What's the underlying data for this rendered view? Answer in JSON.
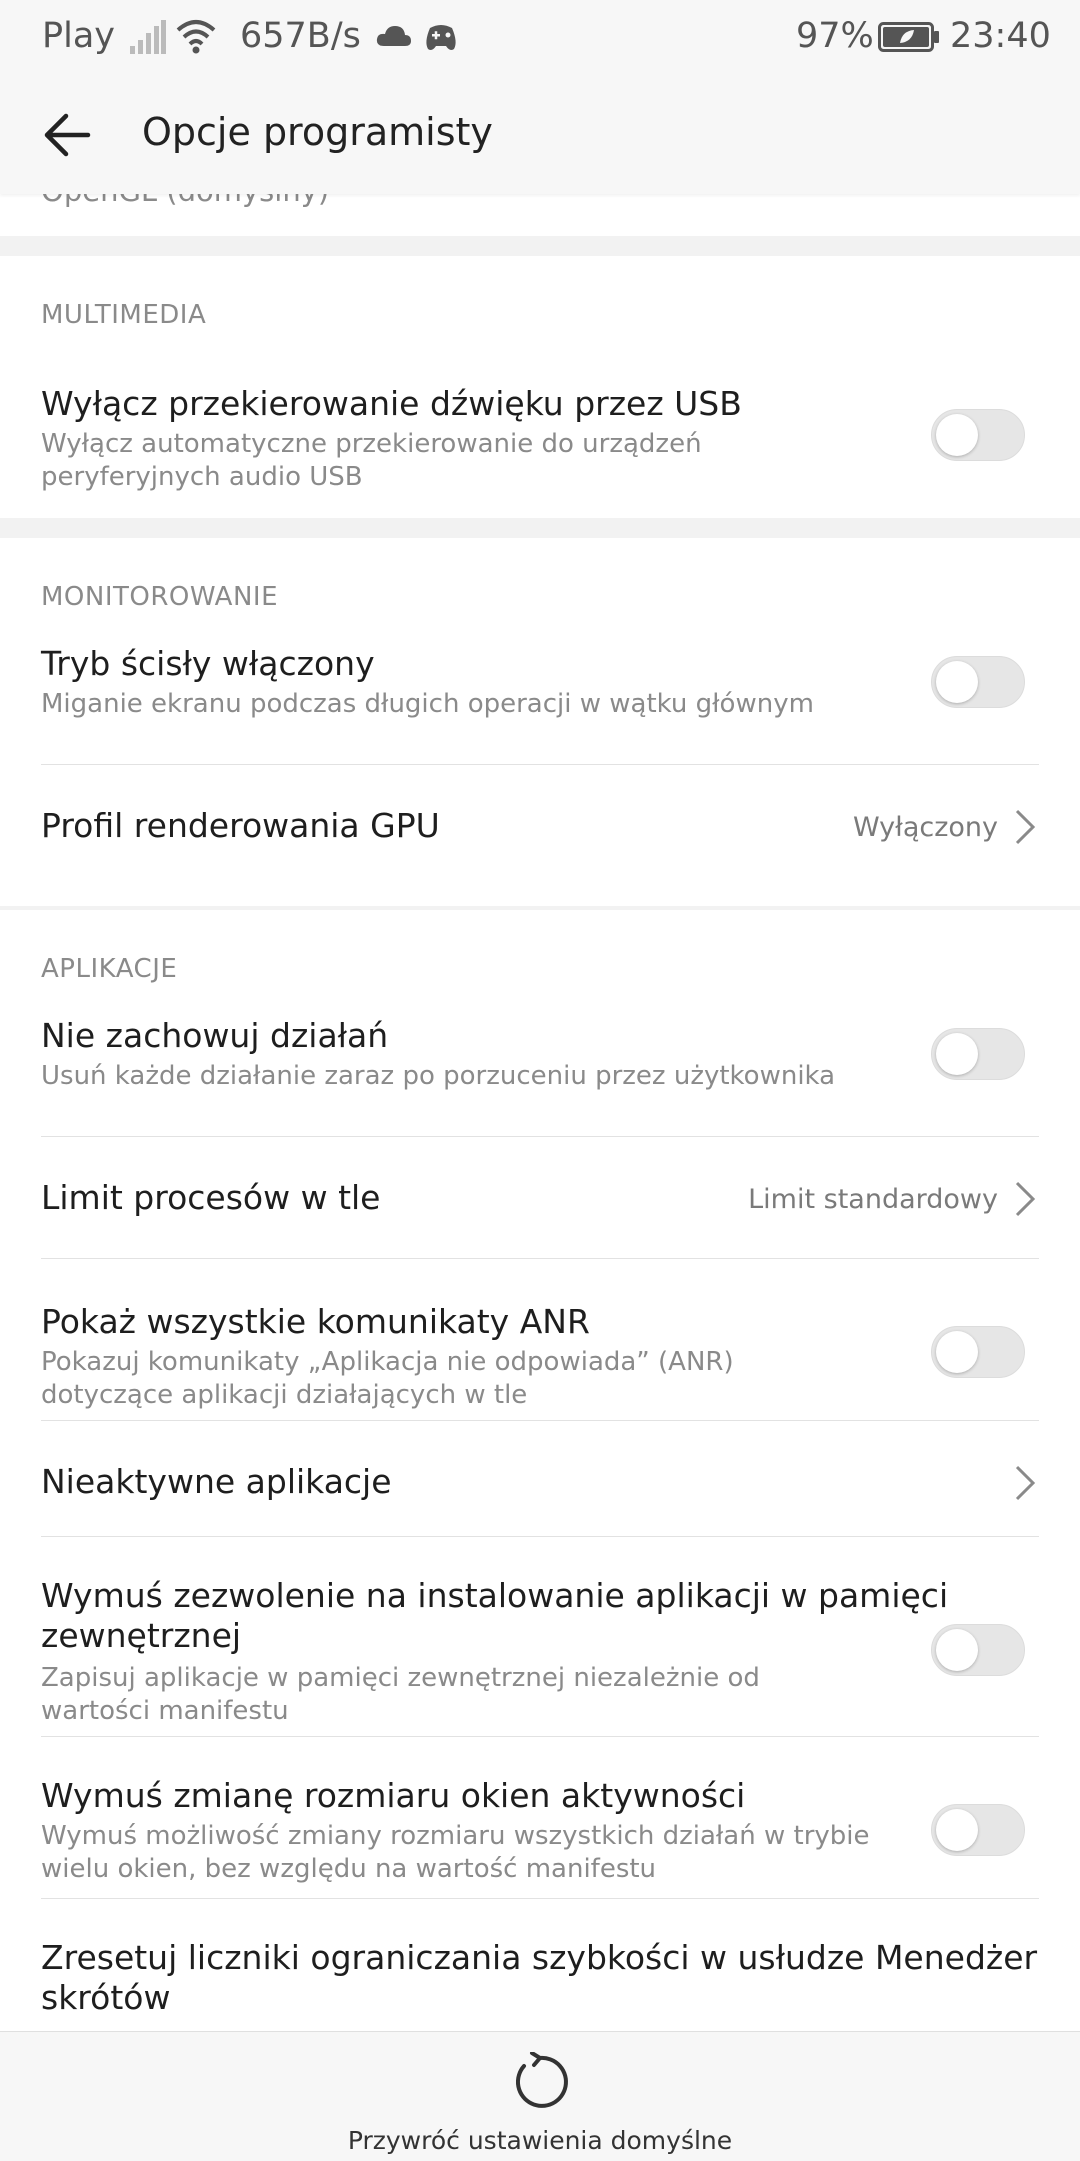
{
  "status_bar": {
    "carrier": "Play",
    "speed": "657B/s",
    "battery": "97%",
    "time": "23:40"
  },
  "header": {
    "title": "Opcje programisty"
  },
  "top_clipped_text": "OpenGL (domyślny)",
  "sections": {
    "multimedia": {
      "header": "MULTIMEDIA",
      "usb_audio": {
        "title": "Wyłącz przekierowanie dźwięku przez USB",
        "subtitle": "Wyłącz automatyczne przekierowanie do urządzeń peryferyjnych audio USB",
        "enabled": false
      }
    },
    "monitoring": {
      "header": "MONITOROWANIE",
      "strict_mode": {
        "title": "Tryb ścisły włączony",
        "subtitle": "Miganie ekranu podczas długich operacji w wątku głównym",
        "enabled": false
      },
      "gpu_profile": {
        "title": "Profil renderowania GPU",
        "value": "Wyłączony"
      }
    },
    "apps": {
      "header": "APLIKACJE",
      "dont_keep": {
        "title": "Nie zachowuj działań",
        "subtitle": "Usuń każde działanie zaraz po porzuceniu przez użytkownika",
        "enabled": false
      },
      "bg_limit": {
        "title": "Limit procesów w tle",
        "value": "Limit standardowy"
      },
      "anr": {
        "title": "Pokaż wszystkie komunikaty ANR",
        "subtitle": "Pokazuj komunikaty „Aplikacja nie odpowiada” (ANR) dotyczące aplikacji działających w tle",
        "enabled": false
      },
      "inactive_apps": {
        "title": "Nieaktywne aplikacje"
      },
      "external_install": {
        "title_line1": "Wymuś zezwolenie na instalowanie aplikacji w pamięci",
        "title_line2": "zewnętrznej",
        "subtitle": "Zapisuj aplikacje w pamięci zewnętrznej niezależnie od wartości manifestu",
        "enabled": false
      },
      "resize_activities": {
        "title": "Wymuś zmianę rozmiaru okien aktywności",
        "subtitle": "Wymuś możliwość zmiany rozmiaru wszystkich działań w trybie wielu okien, bez względu na wartość manifestu",
        "enabled": false
      },
      "reset_shortcut": {
        "title_line1": "Zresetuj liczniki ograniczania szybkości w usłudze Menedżer",
        "title_line2": "skrótów"
      }
    }
  },
  "bottom_bar": {
    "label": "Przywróć ustawienia domyślne"
  },
  "colors": {
    "background": "#f2f2f2",
    "card": "#ffffff",
    "toggle_off": "#e6e6e6",
    "secondary_text": "#8a8a8a"
  },
  "icons": [
    "back-arrow-icon",
    "signal-icon",
    "wifi-icon",
    "cloud-icon",
    "game-controller-icon",
    "battery-icon",
    "chevron-right-icon",
    "reset-icon"
  ]
}
